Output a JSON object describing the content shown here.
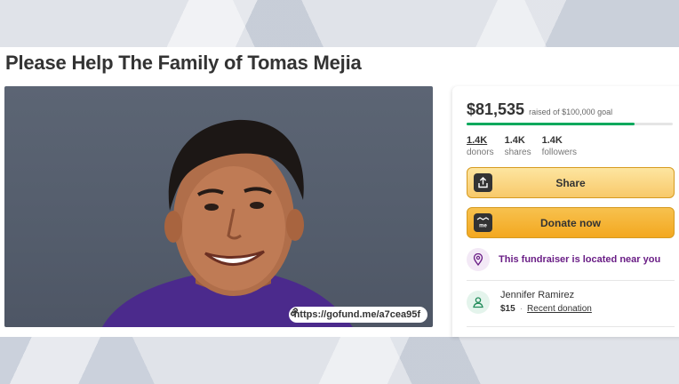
{
  "page_title": "Please Help The Family of Tomas Mejia",
  "photo": {
    "link_text": "https://gofund.me/a7cea95f"
  },
  "fundraiser": {
    "amount_raised": "$81,535",
    "goal_text": "raised of $100,000 goal",
    "progress": 0.815,
    "stats": [
      {
        "value": "1.4K",
        "label": "donors"
      },
      {
        "value": "1.4K",
        "label": "shares"
      },
      {
        "value": "1.4K",
        "label": "followers"
      }
    ],
    "share_label": "Share",
    "donate_label": "Donate now",
    "location_text": "This fundraiser is located near you",
    "recent_donor": {
      "name": "Jennifer Ramirez",
      "amount": "$15",
      "tag": "Recent donation"
    }
  },
  "colors": {
    "progress": "#02a95c",
    "share_button": "#f8c96a",
    "donate_button": "#f3a820",
    "location_text": "#6a1e86"
  },
  "icons": {
    "link": "link-icon",
    "share": "share-icon",
    "donate": "gofundme-logo-icon",
    "location": "location-pin-icon",
    "donor": "user-icon"
  }
}
